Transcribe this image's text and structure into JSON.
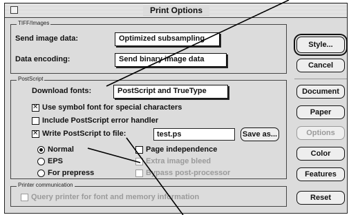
{
  "dialog": {
    "title": "Print Options"
  },
  "tiff_group": {
    "label": "TIFF/Images",
    "send_label": "Send image data:",
    "send_value": "Optimized subsampling",
    "encoding_label": "Data encoding:",
    "encoding_value": "Send binary image data"
  },
  "ps_group": {
    "label": "PostScript",
    "download_label": "Download fonts:",
    "download_value": "PostScript and TrueType",
    "symbol_font": {
      "label": "Use symbol font for special characters",
      "checked": true
    },
    "error_handler": {
      "label": "Include PostScript error handler",
      "checked": false
    },
    "write_file": {
      "label": "Write PostScript to file:",
      "checked": true,
      "filename": "test.ps"
    },
    "save_as": "Save as...",
    "radios": [
      {
        "label": "Normal",
        "selected": true
      },
      {
        "label": "EPS",
        "selected": false
      },
      {
        "label": "For prepress",
        "selected": false
      }
    ],
    "page_independence": "Page independence",
    "extra_image_bleed": "Extra image bleed",
    "bypass_preprocessor": "Bypass post-processor"
  },
  "printer_group": {
    "label": "Printer communication",
    "query_label": "Query printer for font and memory information"
  },
  "buttons": {
    "style": "Style...",
    "cancel": "Cancel",
    "document": "Document",
    "paper": "Paper",
    "options": "Options",
    "color": "Color",
    "features": "Features",
    "reset": "Reset"
  }
}
